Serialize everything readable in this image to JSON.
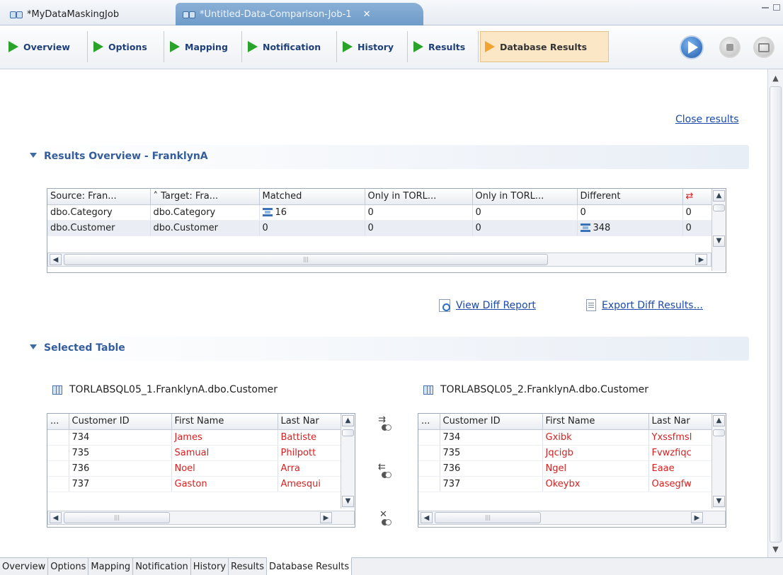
{
  "editor_tabs": [
    {
      "label": "*MyDataMaskingJob",
      "active": false
    },
    {
      "label": "*Untitled-Data-Comparison-Job-1",
      "active": true
    }
  ],
  "flow_tabs": [
    "Overview",
    "Options",
    "Mapping",
    "Notification",
    "History",
    "Results",
    "Database Results"
  ],
  "close_results": "Close results",
  "overview": {
    "title": "Results Overview - FranklynA",
    "columns": [
      "Source: Fran...",
      "Target: Fra...",
      "Matched",
      "Only in TORL...",
      "Only in TORL...",
      "Different",
      ""
    ],
    "rows": [
      [
        "dbo.Category",
        "dbo.Category",
        "16",
        "0",
        "0",
        "0",
        "0"
      ],
      [
        "dbo.Customer",
        "dbo.Customer",
        "0",
        "0",
        "0",
        "348",
        "0"
      ]
    ],
    "view_diff": "View Diff Report",
    "export_diff": "Export Diff Results..."
  },
  "selected": {
    "title": "Selected Table",
    "left": {
      "label": "TORLABSQL05_1.FranklynA.dbo.Customer",
      "columns": [
        "...",
        "Customer ID",
        "First Name",
        "Last Nar"
      ],
      "rows": [
        [
          "",
          "734",
          "James",
          "Battiste"
        ],
        [
          "",
          "735",
          "Samual",
          "Philpott"
        ],
        [
          "",
          "736",
          "Noel",
          "Arra"
        ],
        [
          "",
          "737",
          "Gaston",
          "Amesqui"
        ]
      ]
    },
    "right": {
      "label": "TORLABSQL05_2.FranklynA.dbo.Customer",
      "columns": [
        "...",
        "Customer ID",
        "First Name",
        "Last Nar"
      ],
      "rows": [
        [
          "",
          "734",
          "Gxibk",
          "Yxssfmsl"
        ],
        [
          "",
          "735",
          "Jqcigb",
          "Fvwzfiqc"
        ],
        [
          "",
          "736",
          "Ngel",
          "Eaae"
        ],
        [
          "",
          "737",
          "Okeybx",
          "Oasegfw"
        ]
      ]
    }
  },
  "bottom_tabs": [
    "Overview",
    "Options",
    "Mapping",
    "Notification",
    "History",
    "Results",
    "Database Results"
  ],
  "colors": {
    "accent": "#335d9c",
    "diff_red": "#d82020",
    "active_tab": "#fbe7c6"
  }
}
